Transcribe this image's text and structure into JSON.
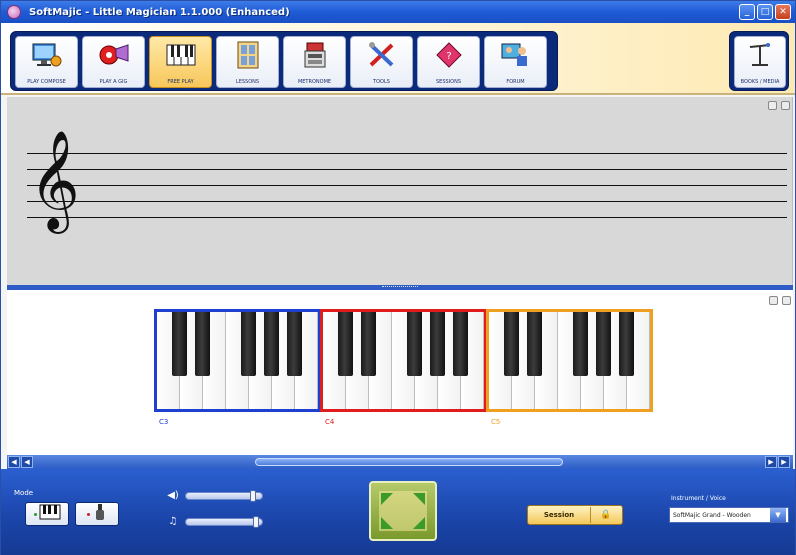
{
  "window": {
    "title": "SoftMajic - Little Magician 1.1.000 (Enhanced)",
    "controls": [
      "_",
      "□",
      "✕"
    ]
  },
  "toolbar": {
    "items": [
      {
        "label": "PLAY COMPOSE",
        "icon": "monitor-icon",
        "active": false
      },
      {
        "label": "PLAY A GIG",
        "icon": "record-icon",
        "active": false
      },
      {
        "label": "FREE PLAY",
        "icon": "keyboard-icon",
        "active": true
      },
      {
        "label": "LESSONS",
        "icon": "lessons-icon",
        "active": false
      },
      {
        "label": "METRONOME",
        "icon": "metronome-icon",
        "active": false
      },
      {
        "label": "TOOLS",
        "icon": "tools-icon",
        "active": false
      },
      {
        "label": "SESSIONS",
        "icon": "diamond-icon",
        "active": false
      },
      {
        "label": "FORUM",
        "icon": "people-icon",
        "active": false
      }
    ],
    "extra": {
      "label": "BOOKS / MEDIA",
      "icon": "stand-icon"
    }
  },
  "staff": {
    "clef": "𝄞",
    "lines": 5
  },
  "keyboard": {
    "octaves": [
      {
        "label": "C3",
        "color": "#1f3fd0"
      },
      {
        "label": "C4",
        "color": "#e01c1c"
      },
      {
        "label": "C5",
        "color": "#f0a020"
      }
    ]
  },
  "scrollbar": {
    "left_arrow": "◀",
    "right_arrow": "▶"
  },
  "bottom": {
    "mode_label": "Mode",
    "volume_icon": "◀)",
    "tempo_icon": "♫",
    "volume_level": 0.92,
    "tempo_level": 0.95,
    "session_label": "Session",
    "lock_icon": "🔒",
    "instrument_label": "Instrument / Voice",
    "instrument_value": "SoftMajic Grand - Wooden"
  },
  "colors": {
    "title_blue": "#1f5bd6",
    "toolbar_navy": "#0b2a7a",
    "bottombar_blue": "#1a44a8",
    "active_gold": "#f7c75a"
  }
}
